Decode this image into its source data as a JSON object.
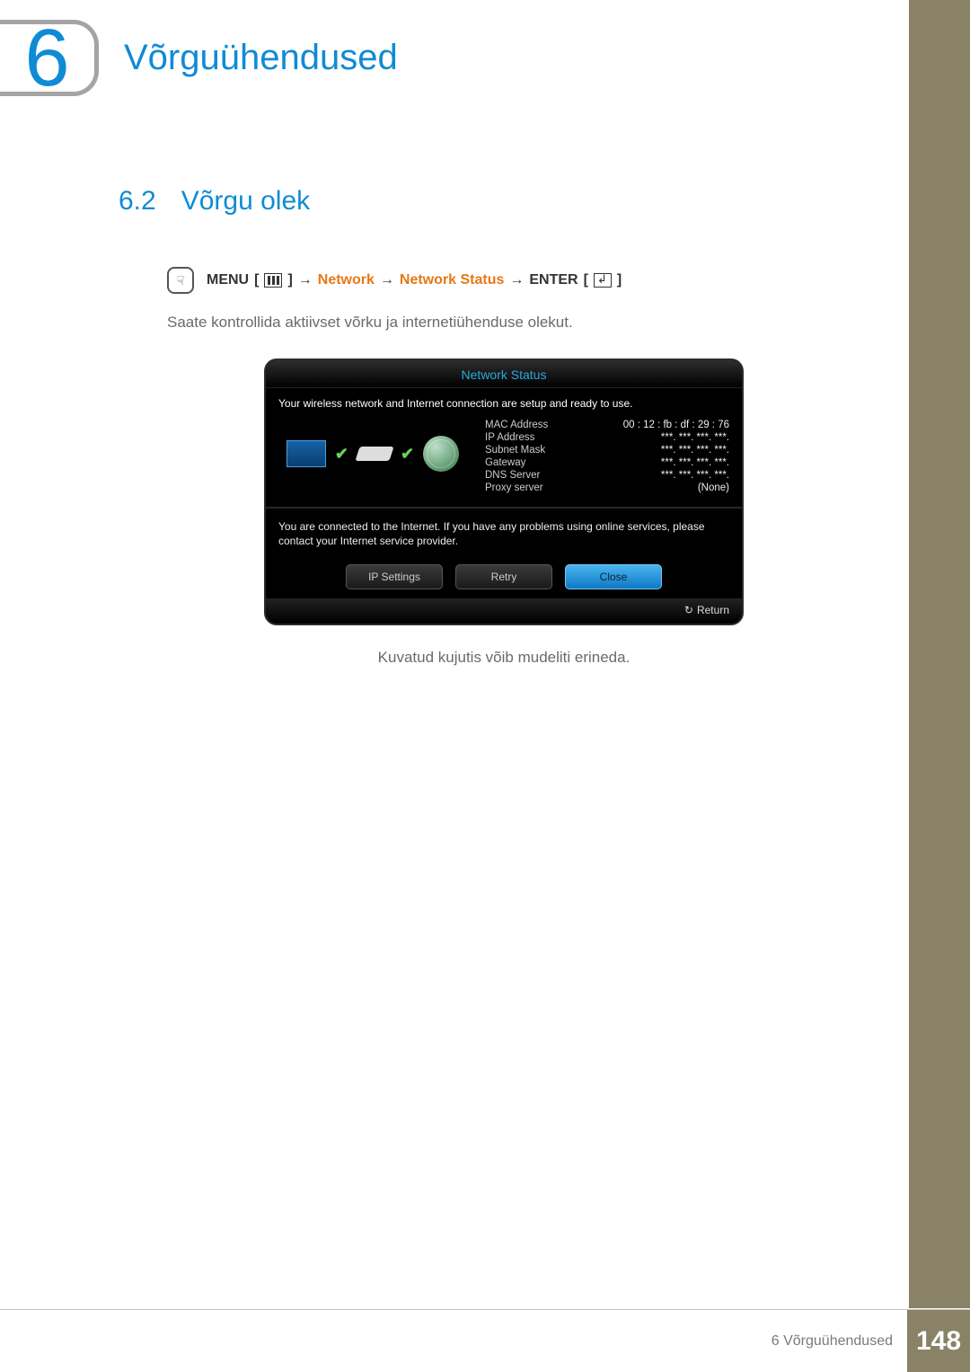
{
  "chapter": {
    "number": "6",
    "title": "Võrguühendused"
  },
  "section": {
    "number": "6.2",
    "title": "Võrgu olek"
  },
  "nav": {
    "menu": "MENU",
    "network": "Network",
    "network_status": "Network Status",
    "enter": "ENTER",
    "arrow": "→"
  },
  "body_text": "Saate kontrollida aktiivset võrku ja internetiühenduse olekut.",
  "osd": {
    "title": "Network Status",
    "status_line": "Your wireless network and Internet connection are setup and ready to use.",
    "rows": [
      {
        "label": "MAC Address",
        "value": "00 : 12 : fb : df : 29 : 76"
      },
      {
        "label": "IP Address",
        "value": "***.   ***.   ***.   ***."
      },
      {
        "label": "Subnet Mask",
        "value": "***.   ***.   ***.   ***."
      },
      {
        "label": "Gateway",
        "value": "***.   ***.   ***.   ***."
      },
      {
        "label": "DNS Server",
        "value": "***.   ***.   ***.   ***."
      },
      {
        "label": "Proxy server",
        "value": "(None)"
      }
    ],
    "message": "You are connected to the Internet. If you have any problems using online services, please contact your Internet service provider.",
    "buttons": {
      "ip": "IP Settings",
      "retry": "Retry",
      "close": "Close"
    },
    "return": "Return"
  },
  "caption": "Kuvatud kujutis võib mudeliti erineda.",
  "footer": {
    "text": "6 Võrguühendused",
    "page": "148"
  }
}
